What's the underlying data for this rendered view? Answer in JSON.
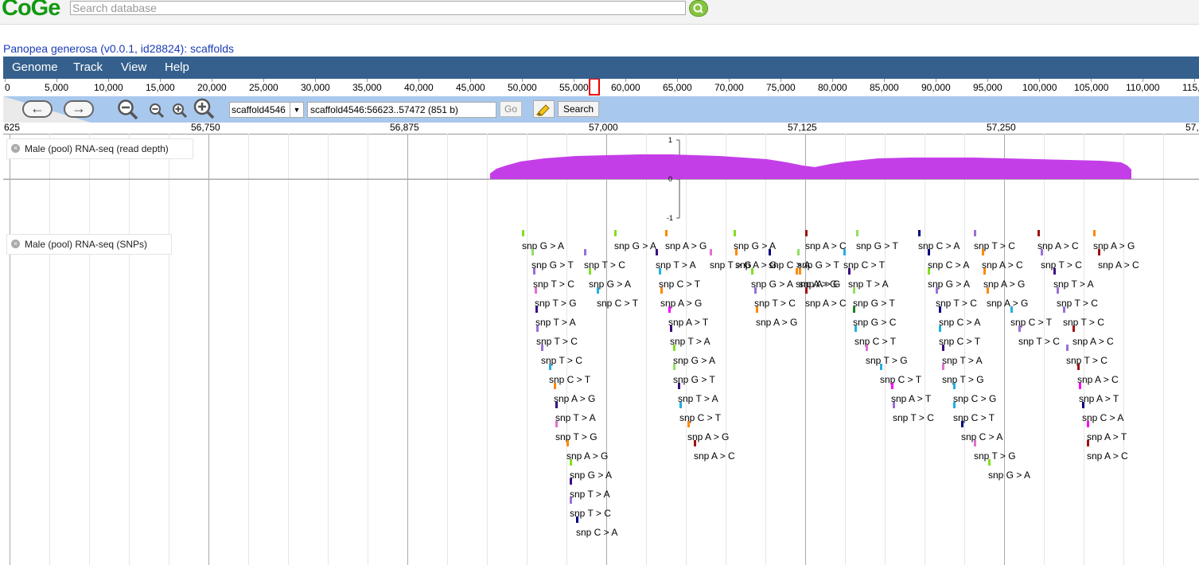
{
  "header": {
    "logo": "CoGe",
    "search_placeholder": "Search database",
    "search_icon": "search-icon"
  },
  "page_title": "Panopea generosa (v0.0.1, id28824): scaffolds",
  "menu": [
    "Genome",
    "Track",
    "View",
    "Help"
  ],
  "overview_ruler": [
    "0",
    "5,000",
    "10,000",
    "15,000",
    "20,000",
    "25,000",
    "30,000",
    "35,000",
    "40,000",
    "45,000",
    "50,000",
    "55,000",
    "60,000",
    "65,000",
    "70,000",
    "75,000",
    "80,000",
    "85,000",
    "90,000",
    "95,000",
    "100,000",
    "105,000",
    "110,000",
    "115,0"
  ],
  "toolbar": {
    "back_icon": "arrow-left-icon",
    "forward_icon": "arrow-right-icon",
    "zoom_icons": [
      "zoom-out-large-icon",
      "zoom-out-icon",
      "zoom-in-icon",
      "zoom-in-large-icon"
    ],
    "scaffold": "scaffold4546",
    "location": "scaffold4546:56623..57472 (851 b)",
    "go_label": "Go",
    "search_label": "Search",
    "highlight_icon": "highlighter-icon"
  },
  "detail_ruler": [
    "625",
    "56,750",
    "56,875",
    "57,000",
    "57,125",
    "57,250",
    "57,"
  ],
  "tracks": {
    "read_depth": {
      "label": "Male (pool) RNA-seq (read depth)",
      "axis": [
        "1",
        "0",
        "-1"
      ],
      "color": "#c43ee8"
    },
    "snps": {
      "label": "Male (pool) RNA-seq (SNPs)",
      "items": [
        {
          "t": "snp G > A",
          "c": "#80e020"
        },
        {
          "t": "snp G > T",
          "c": "#90e060"
        },
        {
          "t": "snp T > C",
          "c": "#9a6fd8"
        },
        {
          "t": "snp T > G",
          "c": "#e070d0"
        },
        {
          "t": "snp T > A",
          "c": "#3a0a80"
        },
        {
          "t": "snp T > C",
          "c": "#9a6fd8"
        },
        {
          "t": "snp T > C",
          "c": "#9a6fd8"
        },
        {
          "t": "snp C > T",
          "c": "#20b0e0"
        },
        {
          "t": "snp A > G",
          "c": "#ff8800"
        },
        {
          "t": "snp T > A",
          "c": "#3a0a80"
        },
        {
          "t": "snp T > G",
          "c": "#e070d0"
        },
        {
          "t": "snp A > G",
          "c": "#ff8800"
        },
        {
          "t": "snp G > A",
          "c": "#80e020"
        },
        {
          "t": "snp T > A",
          "c": "#3a0a80"
        },
        {
          "t": "snp T > C",
          "c": "#9a6fd8"
        },
        {
          "t": "snp C > A",
          "c": "#000080"
        },
        {
          "t": "snp T > C",
          "c": "#9a6fd8"
        },
        {
          "t": "snp G > A",
          "c": "#80e020"
        },
        {
          "t": "snp C > T",
          "c": "#20b0e0"
        },
        {
          "t": "snp G > A",
          "c": "#80e020"
        },
        {
          "t": "snp A > G",
          "c": "#ff8800"
        },
        {
          "t": "snp T > A",
          "c": "#3a0a80"
        },
        {
          "t": "snp C > T",
          "c": "#20b0e0"
        },
        {
          "t": "snp A > G",
          "c": "#ff8800"
        },
        {
          "t": "snp A > T",
          "c": "#ff00ff"
        },
        {
          "t": "snp T > A",
          "c": "#3a0a80"
        },
        {
          "t": "snp G > A",
          "c": "#80e020"
        },
        {
          "t": "snp G > T",
          "c": "#90e060"
        },
        {
          "t": "snp T > A",
          "c": "#3a0a80"
        },
        {
          "t": "snp C > T",
          "c": "#20b0e0"
        },
        {
          "t": "snp A > G",
          "c": "#ff8800"
        },
        {
          "t": "snp A > C",
          "c": "#a01010"
        },
        {
          "t": "snp T > G",
          "c": "#e070d0"
        },
        {
          "t": "snp G > A",
          "c": "#80e020"
        },
        {
          "t": "snp A > G",
          "c": "#ff8800"
        },
        {
          "t": "snp G > A",
          "c": "#80e020"
        },
        {
          "t": "snp T > C",
          "c": "#9a6fd8"
        },
        {
          "t": "snp A > G",
          "c": "#ff8800"
        },
        {
          "t": "snp C > A",
          "c": "#000080"
        },
        {
          "t": "snp A > G",
          "c": "#ff8800"
        },
        {
          "t": "snp A > C",
          "c": "#a01010"
        },
        {
          "t": "snp G > T",
          "c": "#90e060"
        },
        {
          "t": "snp A > G",
          "c": "#ff8800"
        },
        {
          "t": "snp A > C",
          "c": "#a01010"
        },
        {
          "t": "snp G > T",
          "c": "#90e060"
        },
        {
          "t": "snp C > T",
          "c": "#20b0e0"
        },
        {
          "t": "snp T > A",
          "c": "#3a0a80"
        },
        {
          "t": "snp G > T",
          "c": "#90e060"
        },
        {
          "t": "snp G > C",
          "c": "#208020"
        },
        {
          "t": "snp C > T",
          "c": "#20b0e0"
        },
        {
          "t": "snp T > G",
          "c": "#e070d0"
        },
        {
          "t": "snp C > T",
          "c": "#20b0e0"
        },
        {
          "t": "snp A > T",
          "c": "#ff00ff"
        },
        {
          "t": "snp T > C",
          "c": "#9a6fd8"
        },
        {
          "t": "snp C > A",
          "c": "#000080"
        },
        {
          "t": "snp C > A",
          "c": "#000080"
        },
        {
          "t": "snp G > A",
          "c": "#80e020"
        },
        {
          "t": "snp T > C",
          "c": "#9a6fd8"
        },
        {
          "t": "snp C > A",
          "c": "#000080"
        },
        {
          "t": "snp C > T",
          "c": "#20b0e0"
        },
        {
          "t": "snp T > A",
          "c": "#3a0a80"
        },
        {
          "t": "snp T > G",
          "c": "#e070d0"
        },
        {
          "t": "snp C > G",
          "c": "#20b0e0"
        },
        {
          "t": "snp C > T",
          "c": "#20b0e0"
        },
        {
          "t": "snp C > A",
          "c": "#000080"
        },
        {
          "t": "snp T > G",
          "c": "#e070d0"
        },
        {
          "t": "snp G > A",
          "c": "#80e020"
        },
        {
          "t": "snp T > C",
          "c": "#9a6fd8"
        },
        {
          "t": "snp A > C",
          "c": "#ff8800"
        },
        {
          "t": "snp A > G",
          "c": "#ff8800"
        },
        {
          "t": "snp A > G",
          "c": "#ff8800"
        },
        {
          "t": "snp C > T",
          "c": "#20b0e0"
        },
        {
          "t": "snp T > C",
          "c": "#9a6fd8"
        },
        {
          "t": "snp A > C",
          "c": "#a01010"
        },
        {
          "t": "snp T > C",
          "c": "#9a6fd8"
        },
        {
          "t": "snp T > A",
          "c": "#3a0a80"
        },
        {
          "t": "snp T > C",
          "c": "#9a6fd8"
        },
        {
          "t": "snp T > C",
          "c": "#9a6fd8"
        },
        {
          "t": "snp A > C",
          "c": "#a01010"
        },
        {
          "t": "snp T > C",
          "c": "#9a6fd8"
        },
        {
          "t": "snp A > C",
          "c": "#a01010"
        },
        {
          "t": "snp A > T",
          "c": "#ff00ff"
        },
        {
          "t": "snp C > A",
          "c": "#000080"
        },
        {
          "t": "snp A > T",
          "c": "#ff00ff"
        },
        {
          "t": "snp A > C",
          "c": "#a01010"
        },
        {
          "t": "snp A > G",
          "c": "#ff8800"
        },
        {
          "t": "snp A > C",
          "c": "#a01010"
        }
      ]
    }
  }
}
